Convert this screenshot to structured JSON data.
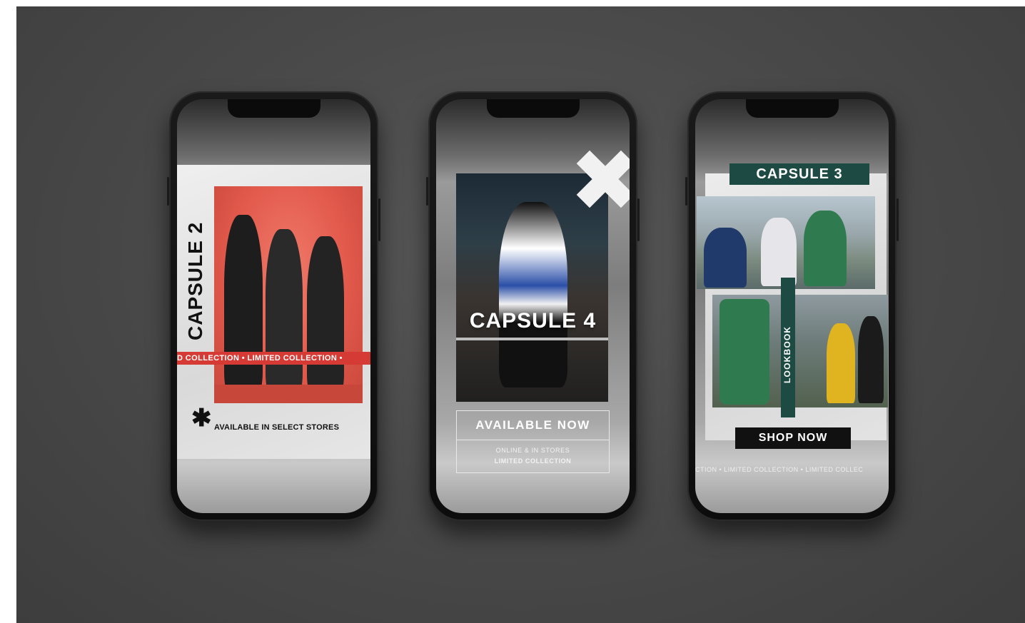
{
  "phones": [
    {
      "title": "CAPSULE 2",
      "band_text": "D COLLECTION • LIMITED COLLECTION •",
      "star": "✱",
      "tagline": "AVAILABLE IN SELECT STORES",
      "accent": "#d63a34"
    },
    {
      "title": "CAPSULE 4",
      "cta": "AVAILABLE NOW",
      "line1": "ONLINE & IN STORES",
      "line2": "LIMITED COLLECTION"
    },
    {
      "title": "CAPSULE 3",
      "side_label": "LOOKBOOK",
      "cta": "SHOP NOW",
      "ticker": "CTION • LIMITED COLLECTION • LIMITED COLLEC",
      "accent": "#1d4a42"
    }
  ]
}
